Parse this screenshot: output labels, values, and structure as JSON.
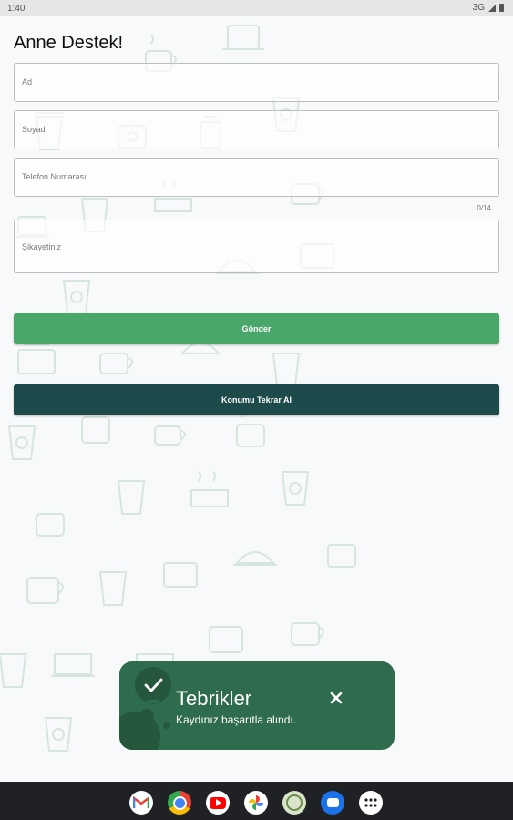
{
  "status_bar": {
    "time": "1:40",
    "network": "3G"
  },
  "page": {
    "title": "Anne Destek!"
  },
  "form": {
    "first_name_label": "Ad",
    "last_name_label": "Soyad",
    "phone_label": "Telefon Numarası",
    "phone_counter": "0/14",
    "complaint_label": "Şikayetiniz"
  },
  "buttons": {
    "submit_label": "Gönder",
    "relocate_label": "Konumu Tekrar Al"
  },
  "toast": {
    "title": "Tebrikler",
    "message": "Kaydınız başarıtla alındı."
  },
  "dock": {
    "apps": [
      "gmail-icon",
      "chrome-icon",
      "youtube-icon",
      "photos-icon",
      "app-icon",
      "messages-icon",
      "app-drawer-icon"
    ]
  },
  "colors": {
    "primary_button": "#4aa76a",
    "secondary_button": "#1d4a4b",
    "toast_background": "#2f6b4d"
  }
}
